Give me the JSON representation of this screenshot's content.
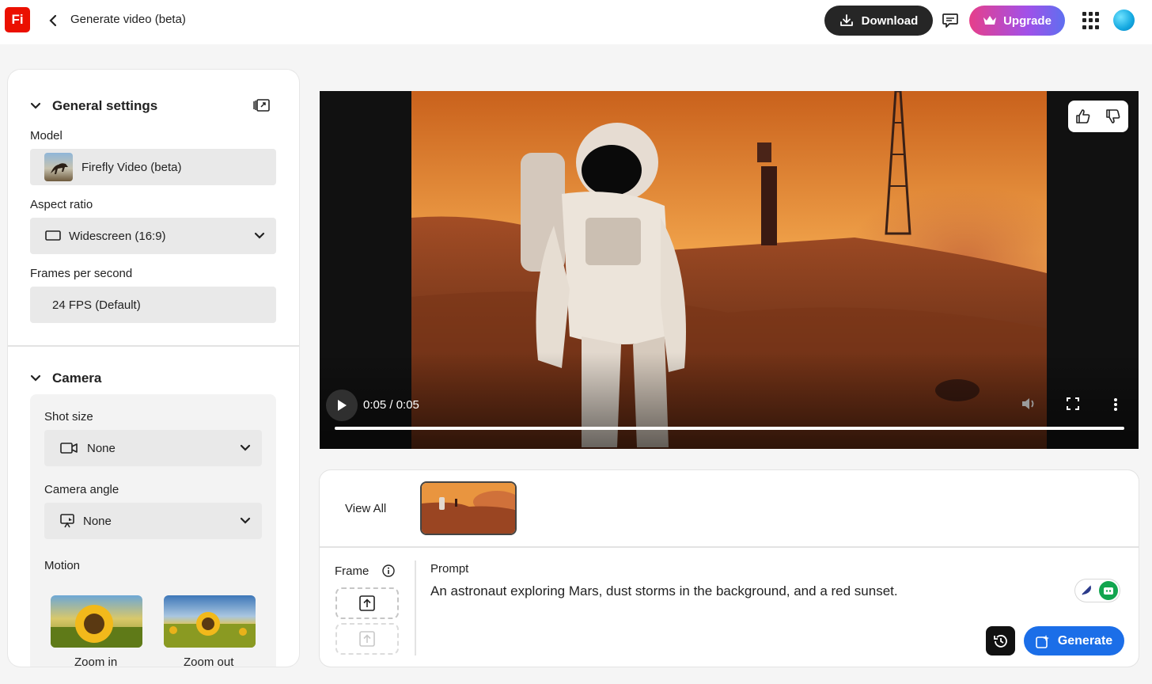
{
  "app": {
    "logo_text": "Fi",
    "title": "Generate video (beta)"
  },
  "header": {
    "download_label": "Download",
    "upgrade_label": "Upgrade"
  },
  "sidebar": {
    "general_settings_title": "General settings",
    "model_label": "Model",
    "model_value": "Firefly Video (beta)",
    "aspect_label": "Aspect ratio",
    "aspect_value": "Widescreen (16:9)",
    "fps_label": "Frames per second",
    "fps_value": "24 FPS (Default)",
    "camera_title": "Camera",
    "shot_size_label": "Shot size",
    "shot_size_value": "None",
    "camera_angle_label": "Camera angle",
    "camera_angle_value": "None",
    "motion_label": "Motion",
    "motion_options": [
      "Zoom in",
      "Zoom out"
    ]
  },
  "player": {
    "time": "0:05 / 0:05",
    "progress": 1.0
  },
  "panel": {
    "view_all_label": "View All",
    "frame_label": "Frame",
    "prompt_label": "Prompt",
    "prompt_text": "An astronaut exploring Mars, dust storms in the background, and a red sunset.",
    "generate_label": "Generate"
  },
  "colors": {
    "accent": "#1b6ee8",
    "logo": "#eb1000",
    "download_bg": "#262626"
  }
}
